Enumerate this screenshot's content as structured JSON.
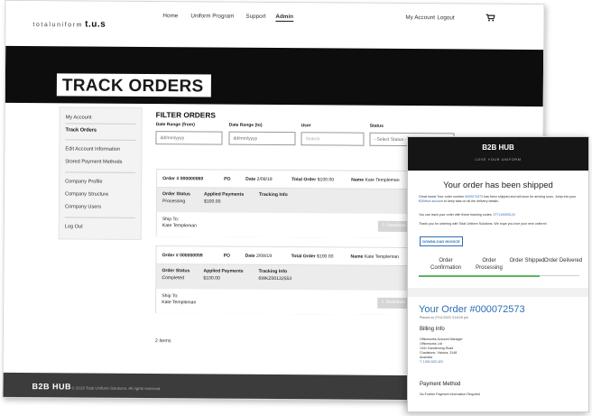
{
  "header": {
    "logo_text": "totaluniform",
    "logo_mark": "t.u.s",
    "nav": [
      "Home",
      "Uniform Program",
      "Support",
      "Admin"
    ],
    "account": "My Account",
    "logout": "Logout",
    "cart_icon": "cart-icon"
  },
  "page_title": "TRACK ORDERS",
  "sidebar": {
    "items": [
      "My Account",
      "Track Orders",
      "Edit Account Information",
      "Stored Payment Methods",
      "Company Profile",
      "Company Structure",
      "Company Users",
      "Log Out"
    ]
  },
  "filter": {
    "title": "FILTER ORDERS",
    "labels": [
      "Date Range (from)",
      "Date Range (to)",
      "User",
      "Status"
    ],
    "date_from_placeholder": "dd/mm/yyyy",
    "date_to_placeholder": "dd/mm/yyyy",
    "user_placeholder": "Search",
    "status_value": "- Select Status -"
  },
  "orders": [
    {
      "order_label": "Order #",
      "order_no": "000000060",
      "po_label": "PO",
      "date_label": "Date",
      "date": "2/08/19",
      "total_label": "Total Order",
      "total": "$100.00",
      "name_label": "Name",
      "name": "Kate Templeman",
      "status_label": "Order Status",
      "status": "Processing",
      "payments_label": "Applied Payments",
      "payments": "$100.00",
      "tracking_label": "Tracking Info",
      "tracking": "",
      "shipto_label": "Ship To:",
      "shipto": "Kate Templeman",
      "download": "Download"
    },
    {
      "order_label": "Order #",
      "order_no": "000000059",
      "po_label": "PO",
      "date_label": "Date",
      "date": "2/08/19",
      "total_label": "Total Order",
      "total": "$100.00",
      "name_label": "Name",
      "name": "Kate Templeman",
      "status_label": "Order Status",
      "status": "Completed",
      "payments_label": "Applied Payments",
      "payments": "$100.00",
      "tracking_label": "Tracking Info",
      "tracking": "6WKZ00132553",
      "shipto_label": "Ship To:",
      "shipto": "Kate Templeman",
      "download": "Download"
    }
  ],
  "items_count": "2 Items",
  "footer": {
    "logo": "B2B HUB",
    "copyright": "© 2019 Total Uniform Solutions. All rights reserved."
  },
  "email": {
    "logo": "B2B HUB",
    "tagline": "LOVE YOUR UNIFORM",
    "heading": "Your order has been shipped",
    "para1_pre": "Great news! Your order number",
    "para1_link": "#000072573",
    "para1_mid": "has been shipped and will soon be arriving soon. Jump into your",
    "para1_link2": "B2BHub account",
    "para1_post": "to keep tabs on all the delivery details.",
    "para2_pre": "You can track your order with these tracking codes:",
    "para2_code": "3TTL00000124",
    "para3": "Thank you for ordering with Total Uniform Solutions. We hope you love your new uniform!",
    "download_invoice": "DOWNLOAD INVOICE",
    "steps": [
      "Order Confirmation",
      "Order Processing",
      "Order Shipped",
      "Order Delivered"
    ],
    "progress": 0.75,
    "progress_color": "#5ab55e",
    "order_title": "Your Order #000072573",
    "placed": "Placed on 27/11/2023 3:18:29 pm",
    "billing_heading": "Billing Info",
    "billing_lines": [
      "Officeworks Account Manager",
      "Officeworks Ltd",
      "1341 Dandenong Road",
      "Chadstone, Victoria, 3148",
      "Australia"
    ],
    "billing_phone": "T: 1300 633 423",
    "payment_heading": "Payment Method",
    "payment_note": "No Further Payment Information Required"
  }
}
